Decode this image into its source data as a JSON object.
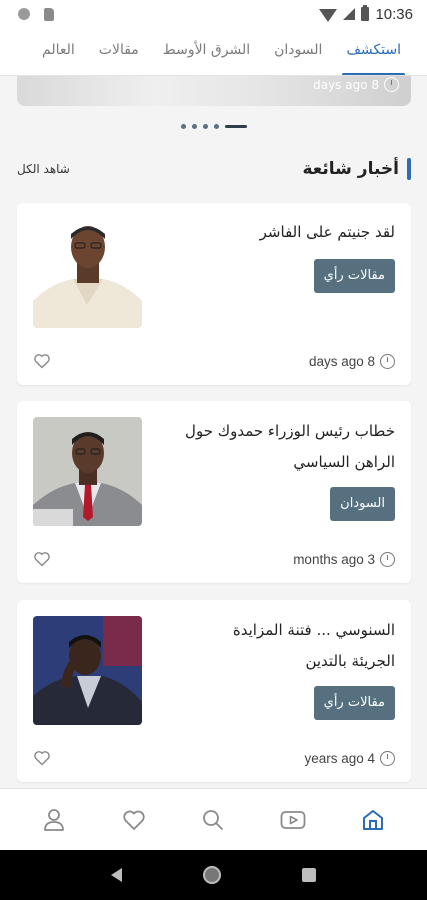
{
  "status_bar": {
    "time": "10:36"
  },
  "tabs": [
    {
      "label": "استكشف",
      "active": true
    },
    {
      "label": "السودان",
      "active": false
    },
    {
      "label": "الشرق الأوسط",
      "active": false
    },
    {
      "label": "مقالات",
      "active": false
    },
    {
      "label": "العالم",
      "active": false
    }
  ],
  "carousel": {
    "time": "days ago 8",
    "slide_count": 5,
    "active_slide": 5
  },
  "section": {
    "title": "أخبار شائعة",
    "see_all": "شاهد الكل"
  },
  "articles": [
    {
      "title": "لقد جنيتم على الفاشر",
      "category": "مقالات رأي",
      "time": "days ago 8"
    },
    {
      "title": "خطاب رئيس الوزراء حمدوك حول الراهن السياسي",
      "category": "السودان",
      "time": "months ago 3"
    },
    {
      "title": "السنوسي ... فتنة المزايدة الجريئة بالتدين",
      "category": "مقالات رأي",
      "time": "years ago 4"
    }
  ],
  "bottom_nav": [
    {
      "icon": "home-icon",
      "active": true
    },
    {
      "icon": "video-icon",
      "active": false
    },
    {
      "icon": "search-icon",
      "active": false
    },
    {
      "icon": "heart-icon",
      "active": false
    },
    {
      "icon": "profile-icon",
      "active": false
    }
  ],
  "colors": {
    "accent": "#2b6cb3",
    "badge": "#56707f",
    "icon_gray": "#8a8a8a"
  }
}
